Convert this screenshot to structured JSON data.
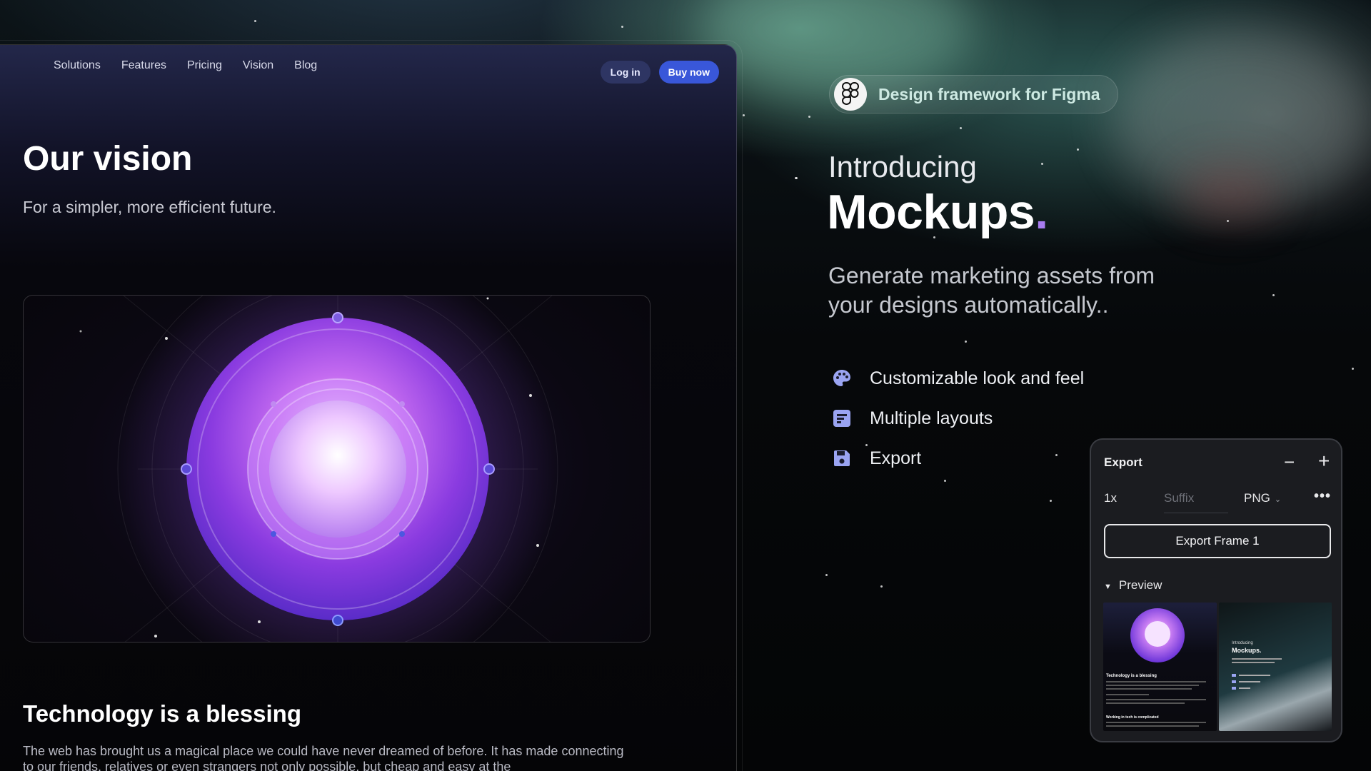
{
  "site": {
    "nav": [
      "Solutions",
      "Features",
      "Pricing",
      "Vision",
      "Blog"
    ],
    "login_label": "Log in",
    "buy_label": "Buy now",
    "vision_title": "Our vision",
    "vision_subtitle": "For a simpler, more efficient future.",
    "tech_title": "Technology is a blessing",
    "tech_text": "The web has brought us a magical place we could have never dreamed of before. It has made connecting to our friends, relatives or even strangers not only possible, but cheap and easy at the"
  },
  "promo": {
    "badge": "Design framework for Figma",
    "intro": "Introducing",
    "product": "Mockups",
    "product_dot": ".",
    "description": "Generate marketing assets from your designs automatically..",
    "features": [
      {
        "icon": "palette-icon",
        "label": "Customizable look and feel"
      },
      {
        "icon": "layout-icon",
        "label": "Multiple layouts"
      },
      {
        "icon": "save-icon",
        "label": "Export"
      }
    ]
  },
  "export_panel": {
    "title": "Export",
    "scale": "1x",
    "suffix_placeholder": "Suffix",
    "format": "PNG",
    "export_button": "Export Frame 1",
    "preview_label": "Preview",
    "thumb_b_intro": "Introducing",
    "thumb_b_title": "Mockups.",
    "thumb_a_title": "Technology is a blessing",
    "thumb_a_subtitle": "Working in tech is complicated"
  },
  "colors": {
    "accent_blue": "#3957d9",
    "accent_purple": "#a87cf0",
    "badge_text": "#cde9e2"
  }
}
